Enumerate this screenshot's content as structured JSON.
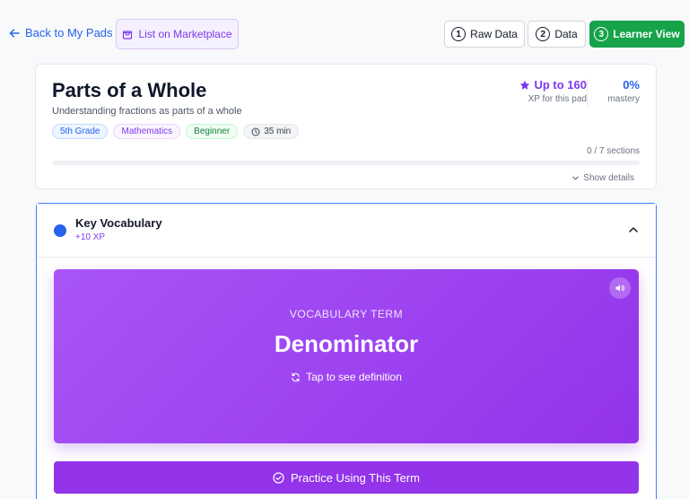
{
  "topbar": {
    "back_label": "Back to My Pads",
    "marketplace_label": "List on Marketplace",
    "views": [
      {
        "num": "1",
        "label": "Raw Data",
        "active": false
      },
      {
        "num": "2",
        "label": "Data",
        "active": false
      },
      {
        "num": "3",
        "label": "Learner View",
        "active": true
      }
    ]
  },
  "pad": {
    "title": "Parts of a Whole",
    "subtitle": "Understanding fractions as parts of a whole",
    "tags": {
      "grade": "5th Grade",
      "subject": "Mathematics",
      "level": "Beginner",
      "duration": "35 min"
    },
    "xp_label": "Up to 160",
    "xp_sub": "XP for this pad",
    "mastery_value": "0%",
    "mastery_label": "mastery",
    "sections_progress": "0 / 7 sections",
    "progress_fraction": 0,
    "show_details_label": "Show details"
  },
  "vocab": {
    "title": "Key Vocabulary",
    "xp": "+10 XP",
    "card_label": "VOCABULARY TERM",
    "term": "Denominator",
    "hint": "Tap to see definition",
    "practice_label": "Practice Using This Term"
  },
  "colors": {
    "accent_blue": "#2563eb",
    "accent_purple": "#9333ea",
    "active_green": "#16a34a"
  }
}
